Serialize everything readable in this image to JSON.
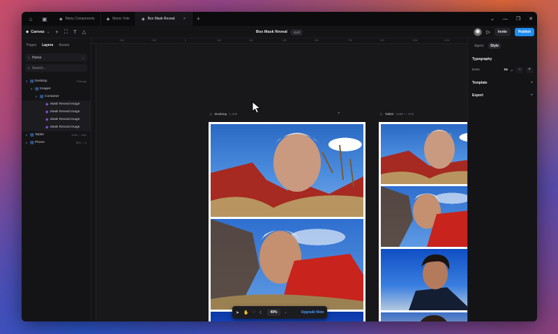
{
  "titlebar": {
    "tabs": [
      {
        "label": "Many Components",
        "active": false
      },
      {
        "label": "Manic Vote",
        "active": false
      },
      {
        "label": "Box Mask Reveal",
        "active": true
      }
    ]
  },
  "toolbar": {
    "canvas_label": "Canvas",
    "doc_title": "Box Mask Reveal",
    "doc_badge": "draft",
    "invite_label": "Invite",
    "publish_label": "Publish"
  },
  "left_panel": {
    "tabs": [
      "Pages",
      "Layers",
      "Assets"
    ],
    "active_tab": "Layers",
    "page_select": "Home",
    "search_placeholder": "Search...",
    "layers": [
      {
        "label": "Desktop",
        "meta": "Primary",
        "depth": 0,
        "icon": "frame"
      },
      {
        "label": "Images",
        "meta": "",
        "depth": 1,
        "icon": "frame"
      },
      {
        "label": "Container",
        "meta": "",
        "depth": 2,
        "icon": "frame"
      },
      {
        "label": "Mask Reveal Image",
        "meta": "",
        "depth": 3,
        "icon": "component"
      },
      {
        "label": "Mask Reveal Image",
        "meta": "",
        "depth": 3,
        "icon": "component"
      },
      {
        "label": "Mask Reveal Image",
        "meta": "",
        "depth": 3,
        "icon": "component"
      },
      {
        "label": "Mask Reveal Image",
        "meta": "",
        "depth": 3,
        "icon": "component"
      },
      {
        "label": "Tablet",
        "meta": "1199 — 810",
        "depth": 0,
        "icon": "frame"
      },
      {
        "label": "Phone",
        "meta": "809 — 0",
        "depth": 0,
        "icon": "frame"
      }
    ]
  },
  "canvas": {
    "frames": [
      {
        "name": "Desktop",
        "size": "1,200"
      },
      {
        "name": "Tablet",
        "size": "1199 — 810"
      }
    ],
    "zoom": "49%",
    "upgrade_label": "Upgrade Now"
  },
  "right_panel": {
    "tabs": [
      "Agent",
      "Style"
    ],
    "active_tab": "Style",
    "sections": {
      "typography": "Typography",
      "base_label": "Base",
      "base_value": "16",
      "base_unit": "px",
      "template": "Template",
      "export": "Export"
    }
  },
  "colors": {
    "accent": "#1f8cf0",
    "frame_icon": "#4a8ff5",
    "component_icon": "#9a6cf2"
  }
}
